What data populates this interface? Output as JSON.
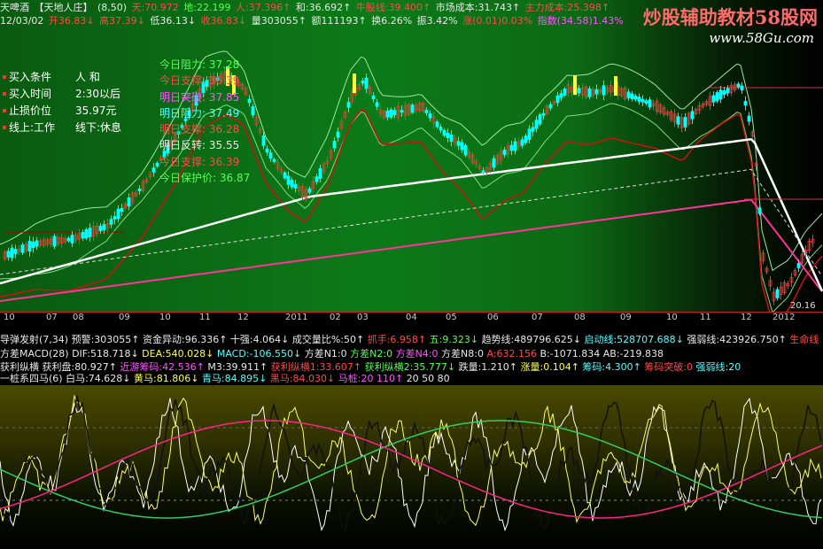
{
  "header": {
    "row1": [
      {
        "text": "天啤酒",
        "color": "w"
      },
      {
        "text": "【天地人庄】",
        "color": "w"
      },
      {
        "text": "(8,50)",
        "color": "w"
      },
      {
        "text": "天:70.972",
        "color": "r"
      },
      {
        "text": "地:22.199",
        "color": "g"
      },
      {
        "text": "人:37.396↑",
        "color": "r"
      },
      {
        "text": "和:36.692↑",
        "color": "w"
      },
      {
        "text": "牛股线:39.400↑",
        "color": "r"
      },
      {
        "text": "市场成本:31.743↑",
        "color": "w"
      },
      {
        "text": "主力成本:25.398↑",
        "color": "r"
      }
    ],
    "row2": [
      {
        "text": "12/03/02",
        "color": "w"
      },
      {
        "text": "开36.83↓",
        "color": "r"
      },
      {
        "text": "高37.39↓",
        "color": "r"
      },
      {
        "text": "低36.13↓",
        "color": "w"
      },
      {
        "text": "收36.83↓",
        "color": "r"
      },
      {
        "text": "量303055↑",
        "color": "w"
      },
      {
        "text": "额111193↑",
        "color": "w"
      },
      {
        "text": "换6.26%",
        "color": "w"
      },
      {
        "text": "振3.42%",
        "color": "w"
      },
      {
        "text": "涨(0.01)0.03%",
        "color": "r"
      },
      {
        "text": "指数(34.58)1.43%",
        "color": "m"
      }
    ]
  },
  "legend": [
    {
      "label": "买入条件",
      "value": "人  和"
    },
    {
      "label": "买入时间",
      "value": "2:30以后"
    },
    {
      "label": "止损价位",
      "value": "35.97元"
    },
    {
      "label": "线上:工作",
      "value": "线下:休息"
    }
  ],
  "levels": [
    {
      "text": "今日阻力: 37.28",
      "color": "g"
    },
    {
      "text": "今日支撑: 36.39",
      "color": "r"
    },
    {
      "text": "明日突破: 37.85",
      "color": "m"
    },
    {
      "text": "明日阻力: 37.49",
      "color": "c"
    },
    {
      "text": "明日支撑: 36.28",
      "color": "r"
    },
    {
      "text": "明日反转: 35.55",
      "color": "w"
    },
    {
      "text": "今日支撑: 36.39",
      "color": "r"
    },
    {
      "text": "今日保护价: 36.87",
      "color": "g"
    }
  ],
  "watermark": {
    "title": "炒股辅助教材58股网",
    "url": "www.58Gu.com"
  },
  "price_low_label": "20.16",
  "axis_labels": [
    "10",
    "07",
    "08",
    "09",
    "10",
    "11",
    "12",
    "2011",
    "02",
    "03",
    "04",
    "05",
    "06",
    "07",
    "08",
    "09",
    "10",
    "11",
    "12",
    "2012"
  ],
  "infobar1": [
    {
      "text": "导弹发射(7,34)",
      "color": "w"
    },
    {
      "text": "预警:303055↑",
      "color": "w"
    },
    {
      "text": "资金异动:96.336↑",
      "color": "w"
    },
    {
      "text": "十强:4.064↓",
      "color": "w"
    },
    {
      "text": "成交量比%:50↑",
      "color": "w"
    },
    {
      "text": "抓手:6.958↑",
      "color": "r"
    },
    {
      "text": "五:9.323↓",
      "color": "g"
    },
    {
      "text": "趋势线:489796.625↓",
      "color": "w"
    },
    {
      "text": "启动线:528707.688↓",
      "color": "c"
    },
    {
      "text": "强弱线:423926.750↑",
      "color": "w"
    },
    {
      "text": "生命线",
      "color": "r"
    }
  ],
  "infobar2": [
    {
      "text": "方差MACD(28)",
      "color": "w"
    },
    {
      "text": "DIF:518.718↓",
      "color": "w"
    },
    {
      "text": "DEA:540.028↓",
      "color": "y"
    },
    {
      "text": "MACD:-106.550↓",
      "color": "c"
    },
    {
      "text": "方差N1:0",
      "color": "w"
    },
    {
      "text": "方差N2:0",
      "color": "g"
    },
    {
      "text": "方差N4:0",
      "color": "m"
    },
    {
      "text": "方差N8:0",
      "color": "w"
    },
    {
      "text": "A:632.156",
      "color": "r"
    },
    {
      "text": "B:-1071.834",
      "color": "w"
    },
    {
      "text": "AB:-219.838",
      "color": "w"
    }
  ],
  "infobar3": [
    {
      "text": "获利纵横 获利盘:80.927↑",
      "color": "w"
    },
    {
      "text": "近游筹码:42.536↑",
      "color": "m"
    },
    {
      "text": "M3:39.911↑",
      "color": "w"
    },
    {
      "text": "获利纵横1:33.607↑",
      "color": "r"
    },
    {
      "text": "获利纵横2:35.777↓",
      "color": "g"
    },
    {
      "text": "跌量:1.210↑",
      "color": "w"
    },
    {
      "text": "涨量:0.104↑",
      "color": "y"
    },
    {
      "text": "筹码:4.300↑",
      "color": "c"
    },
    {
      "text": "筹码突破:0",
      "color": "r"
    },
    {
      "text": "强弱线:20",
      "color": "c"
    }
  ],
  "infobar4": [
    {
      "text": "一桩系四马(6)",
      "color": "w"
    },
    {
      "text": "白马:74.628↓",
      "color": "w"
    },
    {
      "text": "黄马:81.806↓",
      "color": "y"
    },
    {
      "text": "青马:84.895↓",
      "color": "c"
    },
    {
      "text": "黑马:84.030↓",
      "color": "r"
    },
    {
      "text": "马桩:20 110↑",
      "color": "m"
    },
    {
      "text": "20 50 80",
      "color": "w"
    }
  ],
  "colors": {
    "candle_up": "#ff3030",
    "candle_down": "#00ffff",
    "ma_white": "#ffffff",
    "ma_pink": "#ff3399",
    "ma_red": "#cc0000"
  }
}
